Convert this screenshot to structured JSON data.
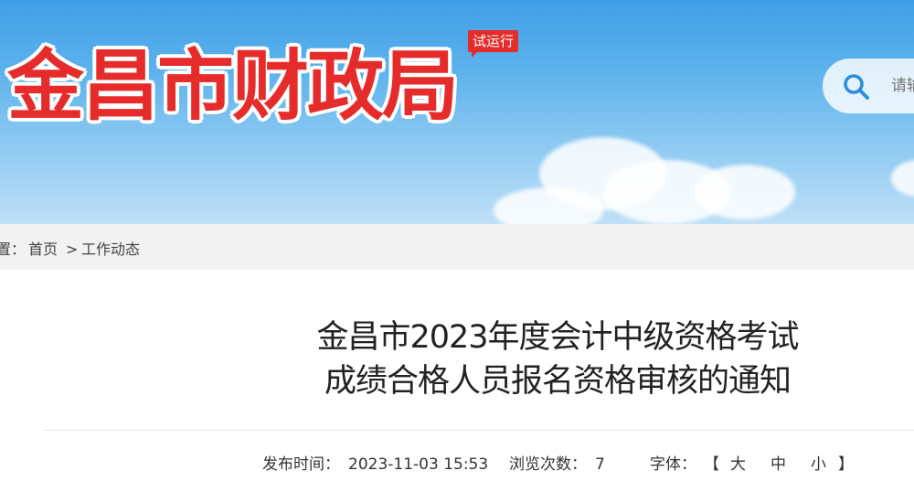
{
  "header": {
    "site_title": "金昌市财政局",
    "trial_badge": "试运行",
    "search": {
      "placeholder": "请输入关键词"
    }
  },
  "breadcrumb": {
    "prefix": "置：",
    "home": "首页",
    "separator": ">",
    "current": "工作动态"
  },
  "article": {
    "title_line1": "金昌市2023年度会计中级资格考试",
    "title_line2": "成绩合格人员报名资格审核的通知",
    "publish_label": "发布时间：",
    "publish_time": "2023-11-03 15:53",
    "views_label": "浏览次数：",
    "views": "7",
    "font_label": "字体：",
    "bracket_open": "【",
    "font_large": "大",
    "font_medium": "中",
    "font_small": "小",
    "bracket_close": "】"
  },
  "colors": {
    "brand_red": "#e62b2b",
    "sky_blue": "#4da6e8",
    "breadcrumb_bg": "#f2f2f2"
  }
}
